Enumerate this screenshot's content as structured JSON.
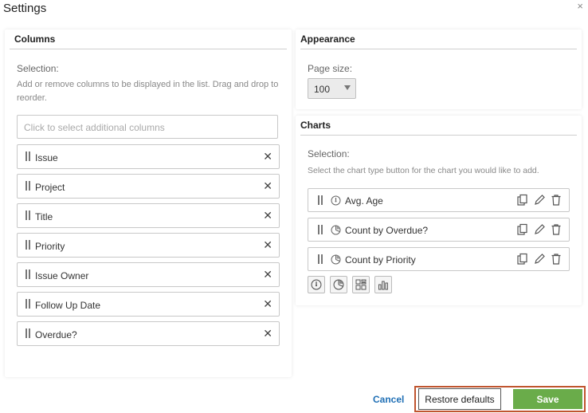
{
  "dialog": {
    "title": "Settings",
    "close_glyph": "×"
  },
  "columns": {
    "header": "Columns",
    "selection_label": "Selection:",
    "help_text": "Add or remove columns to be displayed in the list. Drag and drop to reorder.",
    "add_placeholder": "Click to select additional columns",
    "items": [
      "Issue",
      "Project",
      "Title",
      "Priority",
      "Issue Owner",
      "Follow Up Date",
      "Overdue?"
    ]
  },
  "appearance": {
    "header": "Appearance",
    "page_size_label": "Page size:",
    "page_size_value": "100"
  },
  "charts": {
    "header": "Charts",
    "selection_label": "Selection:",
    "help_text": "Select the chart type button for the chart you would like to add.",
    "items": [
      {
        "label": "Avg. Age",
        "icon": "gauge-icon"
      },
      {
        "label": "Count by Overdue?",
        "icon": "pie-icon"
      },
      {
        "label": "Count by Priority",
        "icon": "pie-icon"
      }
    ],
    "type_buttons": [
      "gauge-icon",
      "pie-icon",
      "grid-icon",
      "bar-chart-icon"
    ]
  },
  "footer": {
    "cancel_label": "Cancel",
    "restore_label": "Restore defaults",
    "save_label": "Save",
    "save_color": "#6aac4a",
    "highlight_color": "#c0552f",
    "link_color": "#1f6fb5"
  }
}
